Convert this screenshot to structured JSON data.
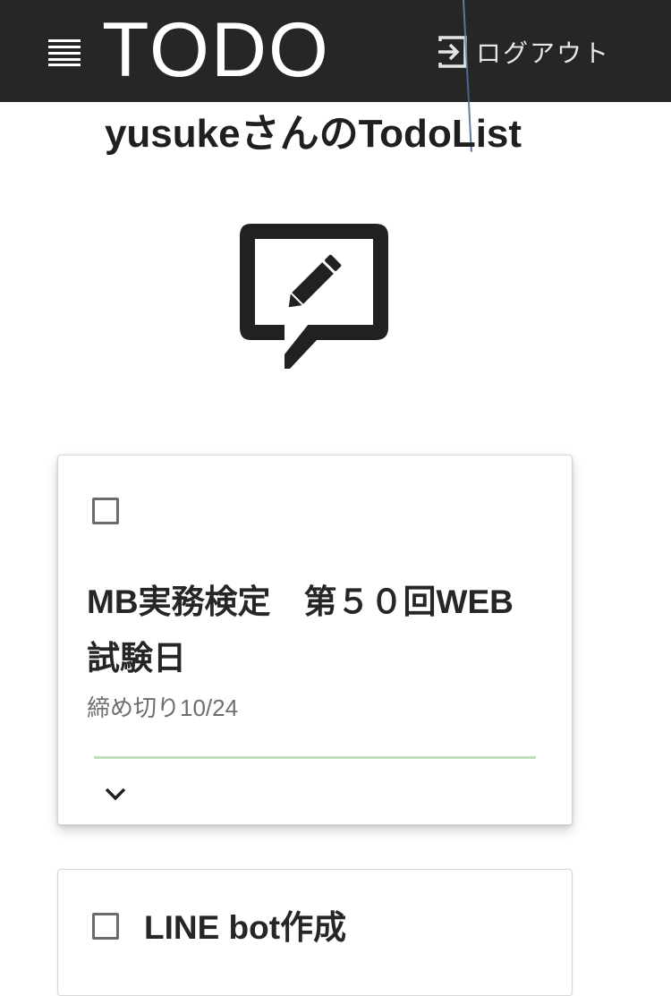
{
  "appbar": {
    "title": "TODO",
    "menu_icon": "menu-icon",
    "logout_icon": "logout-icon",
    "logout_label": "ログアウト",
    "background": "#262626"
  },
  "page": {
    "title": "yusukeさんのTodoList",
    "edit_icon": "edit-comment-icon"
  },
  "todos": [
    {
      "checked": false,
      "title": "MB実務検定　第５０回WEB試験日",
      "deadline": "締め切り10/24",
      "expand_icon": "chevron-down-icon",
      "divider_color": "#bde0b9"
    },
    {
      "checked": false,
      "title": "LINE bot作成"
    }
  ]
}
